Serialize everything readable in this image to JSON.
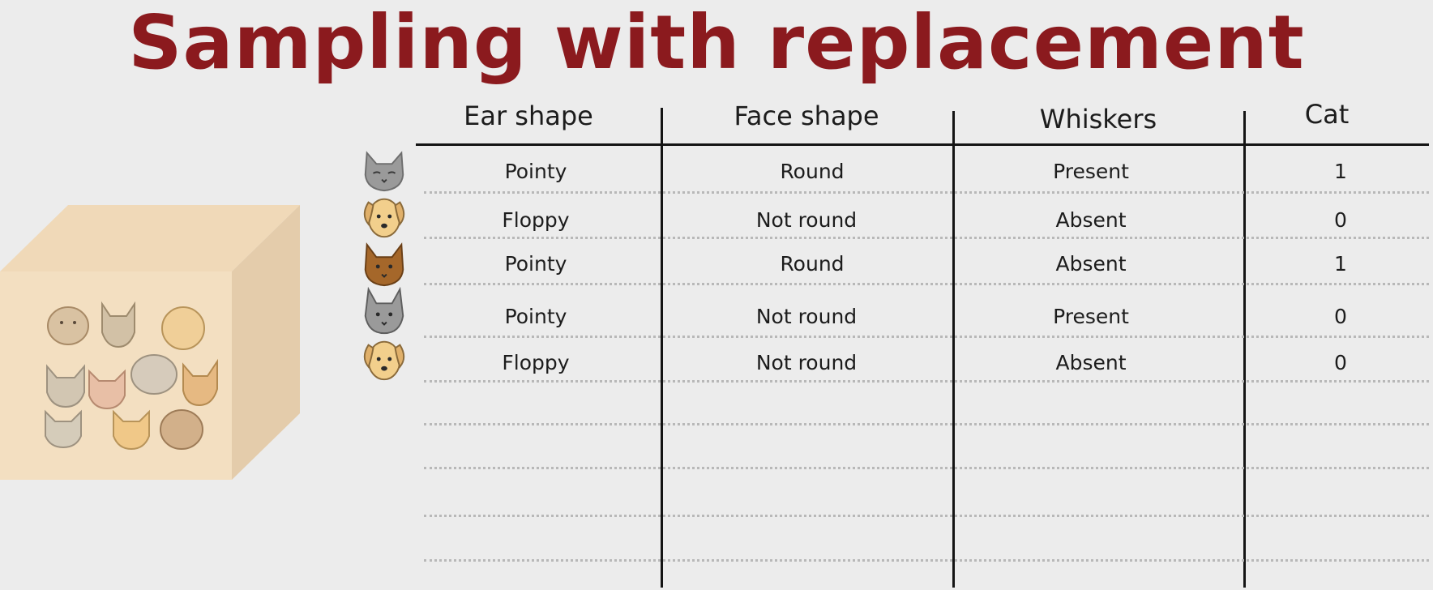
{
  "title": "Sampling with replacement",
  "table": {
    "headers": [
      "Ear shape",
      "Face shape",
      "Whiskers",
      "Cat"
    ],
    "rows": [
      {
        "animal": "gray-cat-icon",
        "ear": "Pointy",
        "face": "Round",
        "whiskers": "Present",
        "cat": "1"
      },
      {
        "animal": "tan-dog-icon",
        "ear": "Floppy",
        "face": "Not round",
        "whiskers": "Absent",
        "cat": "0"
      },
      {
        "animal": "brown-cat-icon",
        "ear": "Pointy",
        "face": "Round",
        "whiskers": "Absent",
        "cat": "1"
      },
      {
        "animal": "gray-cat-icon",
        "ear": "Pointy",
        "face": "Not round",
        "whiskers": "Present",
        "cat": "0"
      },
      {
        "animal": "tan-dog-icon",
        "ear": "Floppy",
        "face": "Not round",
        "whiskers": "Absent",
        "cat": "0"
      }
    ]
  },
  "colors": {
    "title": "#8b1a1e",
    "box_front": "#f3dfc1",
    "box_top": "#f0d9b8",
    "box_side": "#e4ccab",
    "cat_gray": "#9a9a9a",
    "cat_brown": "#a5672a",
    "dog_tan": "#f2cf8c"
  }
}
